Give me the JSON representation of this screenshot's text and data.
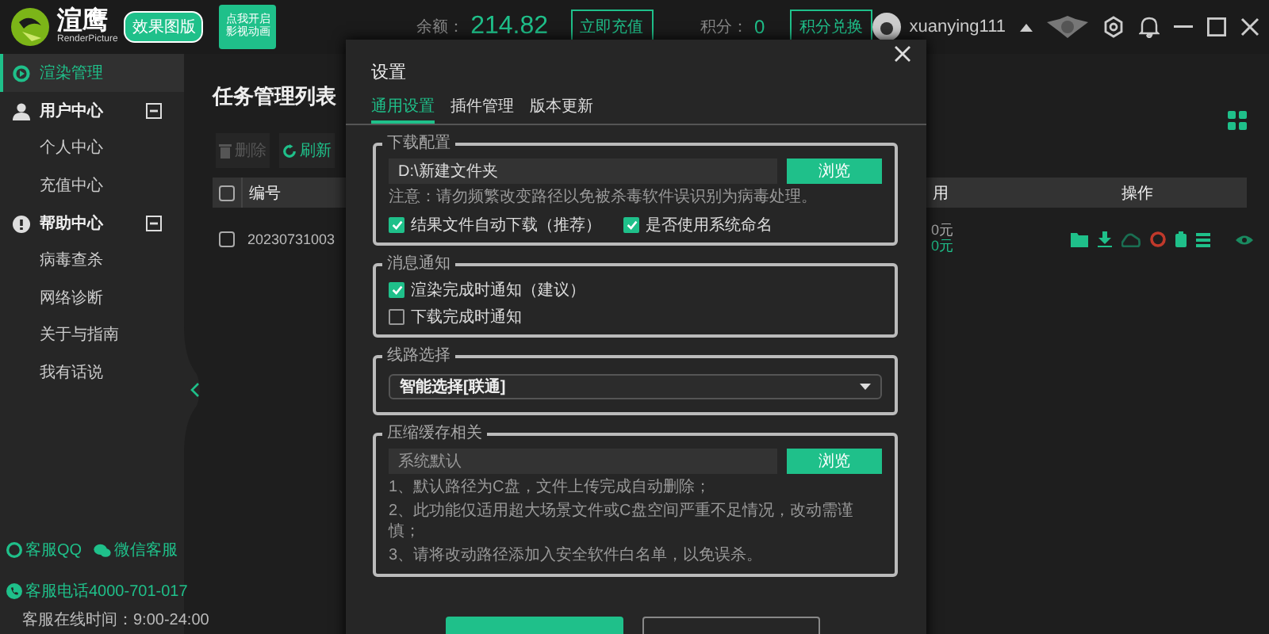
{
  "app": {
    "logo_text": "渲鹰",
    "logo_subtext": "RenderPicture",
    "edition_badge": "效果图版",
    "promo_tag": [
      "点我开启",
      "影视动画"
    ]
  },
  "top_bar": {
    "balance_label": "余额：",
    "balance": "214.82",
    "recharge_button": "立即充值",
    "points_label": "积分：",
    "points": "0",
    "exchange_button": "积分兑换",
    "username": "xuanying111"
  },
  "sidebar": {
    "items": [
      {
        "label": "渲染管理",
        "selected": true
      },
      {
        "label": "用户中心",
        "expanded": true,
        "children": [
          {
            "label": "个人中心",
            "selected": false
          },
          {
            "label": "充值中心",
            "selected": false
          }
        ]
      },
      {
        "label": "帮助中心",
        "expanded": true,
        "children": [
          {
            "label": "病毒查杀",
            "selected": false
          },
          {
            "label": "网络诊断",
            "selected": false
          },
          {
            "label": "关于与指南",
            "selected": false
          },
          {
            "label": "我有话说",
            "selected": false
          }
        ]
      }
    ],
    "contacts": [
      {
        "label": "客服QQ"
      },
      {
        "label": "微信客服"
      }
    ],
    "phone": {
      "label": "客服电话",
      "value": "4000-701-017"
    },
    "hours": "客服在线时间：9:00-24:00"
  },
  "main": {
    "title": "任务管理列表",
    "toolbar": [
      {
        "label": "删除",
        "disabled": true
      },
      {
        "label": "刷新",
        "disabled": false
      }
    ],
    "table": {
      "select_all_checked": false,
      "columns": [
        "编号",
        "用",
        "操作"
      ],
      "rows": [
        {
          "checked": false,
          "id": "20230731003",
          "cost": [
            "0元",
            "0元"
          ]
        }
      ]
    }
  },
  "modal": {
    "title": "设置",
    "tabs": [
      {
        "label": "通用设置",
        "selected": true
      },
      {
        "label": "插件管理",
        "selected": false
      },
      {
        "label": "版本更新",
        "selected": false
      }
    ],
    "sections": [
      {
        "kind": "path",
        "legend": "下载配置",
        "value": "D:\\新建文件夹",
        "button": "浏览",
        "note": "注意：请勿频繁改变路径以免被杀毒软件误识别为病毒处理。",
        "checks": [
          {
            "label": "结果文件自动下载（推荐）",
            "checked": true
          },
          {
            "label": "是否使用系统命名",
            "checked": true
          }
        ]
      },
      {
        "kind": "checks",
        "legend": "消息通知",
        "checks": [
          {
            "label": "渲染完成时通知（建议）",
            "checked": true
          },
          {
            "label": "下载完成时通知",
            "checked": false
          }
        ]
      },
      {
        "kind": "select",
        "legend": "线路选择",
        "value": "智能选择[联通]"
      },
      {
        "kind": "path",
        "legend": "压缩缓存相关",
        "placeholder": "系统默认",
        "button": "浏览",
        "notes": [
          "1、默认路径为C盘，文件上传完成自动删除；",
          "2、此功能仅适用超大场景文件或C盘空间严重不足情况，改动需谨慎；",
          "3、请将改动路径添加入安全软件白名单，以免误杀。"
        ]
      }
    ]
  }
}
